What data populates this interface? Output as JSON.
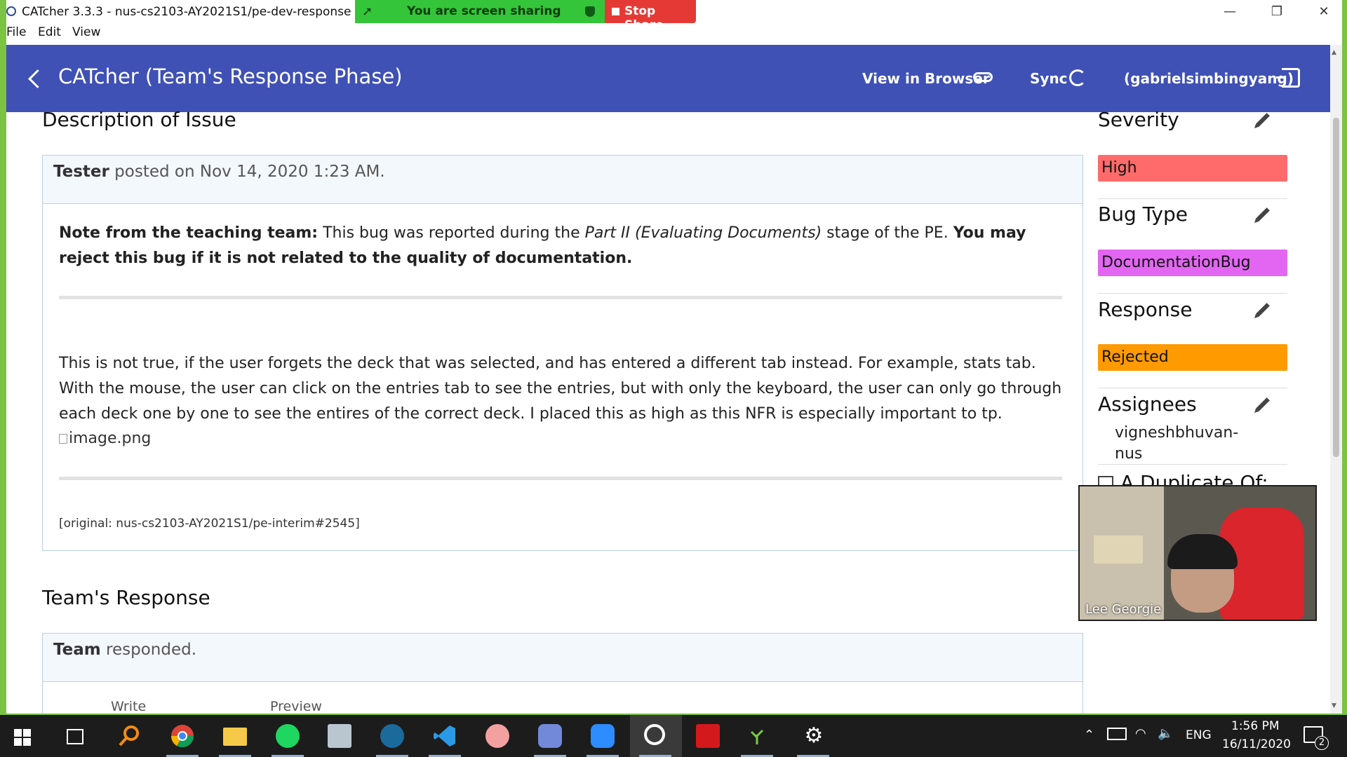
{
  "window": {
    "title": "CATcher 3.3.3 - nus-cs2103-AY2021S1/pe-dev-response",
    "minimize": "—",
    "restore": "❐",
    "close": "✕"
  },
  "share_banner": {
    "text": "You are screen sharing",
    "stop_label": "Stop Share"
  },
  "menu": [
    "File",
    "Edit",
    "View"
  ],
  "header": {
    "title": "CATcher  (Team's Response Phase)",
    "view_in_browser": "View in Browser",
    "sync": "Sync",
    "user": "(gabrielsimbingyang)"
  },
  "issue": {
    "section_title": "Description of Issue",
    "author": "Tester",
    "posted": " posted on Nov 14, 2020 1:23 AM.",
    "note_label": "Note from the teaching team:",
    "note_text_1": " This bug was reported during the ",
    "note_italic": "Part II (Evaluating Documents)",
    "note_text_2": " stage of the PE. ",
    "note_bold": "You may reject this bug if it is not related to the quality of documentation.",
    "body": "This is not true, if the user forgets the deck that was selected, and has entered a different tab instead. For example, stats tab. With the mouse, the user can click on the entries tab to see the entries, but with only the keyboard, the user can only go through each deck one by one to see the entires of the correct deck. I placed this as high as this NFR is especially important to tp.",
    "image_alt": "image.png",
    "original": "[original: nus-cs2103-AY2021S1/pe-interim#2545]"
  },
  "response": {
    "section_title": "Team's Response",
    "author": "Team",
    "text": " responded.",
    "tab_write": "Write",
    "tab_preview": "Preview"
  },
  "side": {
    "severity_title": "Severity",
    "severity_value": "High",
    "severity_color": "#ff6b6b",
    "bugtype_title": "Bug Type",
    "bugtype_value": "DocumentationBug",
    "bugtype_color": "#e266f2",
    "response_title": "Response",
    "response_value": "Rejected",
    "response_color": "#ff9a00",
    "assignees_title": "Assignees",
    "assignee_1": "vigneshbhuvan-",
    "assignee_2": "nus",
    "duplicate_label": "A Duplicate Of:"
  },
  "video": {
    "participant": "Lee Georgie"
  },
  "tray": {
    "language": "ENG",
    "time": "1:56 PM",
    "date": "16/11/2020",
    "notifications": "2"
  },
  "taskbar_icons": [
    "windows-start-icon",
    "task-view-icon",
    "search-icon",
    "chrome-icon",
    "file-explorer-icon",
    "spotify-icon",
    "scanner-icon",
    "steam-icon",
    "vscode-icon",
    "paint-icon",
    "discord-icon",
    "zoom-icon",
    "catcher-icon",
    "acrobat-icon",
    "plant-app-icon",
    "settings-icon"
  ]
}
